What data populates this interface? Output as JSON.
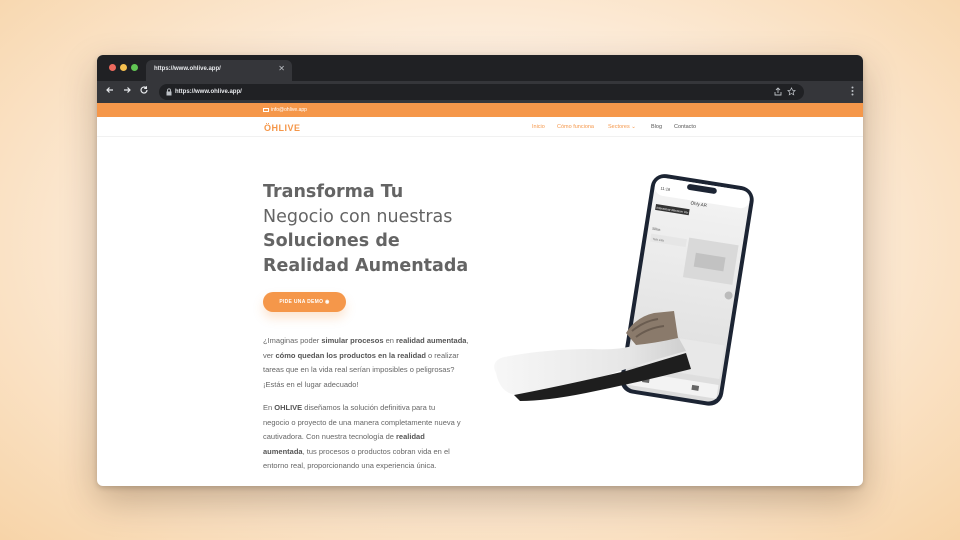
{
  "browser": {
    "tab_title": "https://www.ohlive.app/",
    "tab_close": "✕",
    "url": "https://www.ohlive.app/",
    "icons": [
      "back-icon",
      "forward-icon",
      "reload-icon",
      "lock-icon",
      "share-icon",
      "star-icon",
      "menu-icon"
    ]
  },
  "site": {
    "email": "info@ohlive.app",
    "logo": "ÖHLIVE",
    "nav": [
      "Inicio",
      "Cómo funciona",
      "Sectores ⌄",
      "Blog",
      "Contacto"
    ],
    "hero_title": [
      "Transforma Tu",
      "Negocio con nuestras",
      "Soluciones de",
      "Realidad Aumentada"
    ],
    "cta": "PIDE UNA DEMO ◉",
    "para1": {
      "t1": "¿Imaginas poder ",
      "s1": "simular procesos",
      "t2": " en ",
      "s2": "realidad aumentada",
      "t3": ",",
      "line2a": "ver ",
      "s3": "cómo quedan los productos en la realidad",
      "line2b": " o realizar",
      "line3": "tareas que en la vida real serían imposibles o peligrosas?",
      "line4": "¡Estás en el lugar adecuado!"
    },
    "para2": {
      "t1": "En ",
      "s1": "OHLIVE",
      "t2": " diseñamos la solución definitiva para tu",
      "line2": "negocio o proyecto de una manera completamente nueva y",
      "line3a": "cautivadora. Con nuestra tecnología de ",
      "s2": "realidad",
      "s3": "aumentada",
      "line4b": ", tus procesos o productos cobran vida en el",
      "line5": "entorno real, proporcionando una experiencia única."
    },
    "phone": {
      "time": "11:16",
      "app_title": "Öhly AR",
      "tooltip": "Interactuar Recorrer Ver",
      "list_label_1": "Sillas",
      "list_label_2": "Tela silla",
      "list_label_3": "Bench",
      "list_label_4": "Blanco"
    },
    "colors": {
      "accent": "#f5974a",
      "text": "#646464"
    }
  }
}
